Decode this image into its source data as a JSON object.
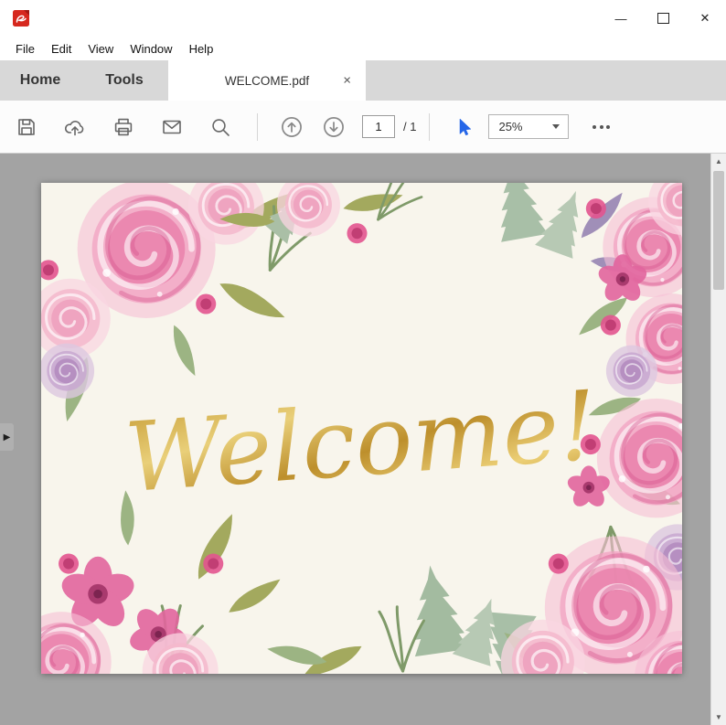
{
  "window": {
    "minimize_glyph": "—",
    "close_glyph": "✕"
  },
  "menu": {
    "items": [
      "File",
      "Edit",
      "View",
      "Window",
      "Help"
    ]
  },
  "tabs": {
    "home": "Home",
    "tools": "Tools",
    "document": "WELCOME.pdf",
    "close_glyph": "×"
  },
  "toolbar": {
    "page_current": "1",
    "page_total": "/ 1",
    "zoom_value": "25%"
  },
  "document": {
    "welcome_text": "Welcome!"
  },
  "scrollbar": {
    "up_glyph": "▲",
    "down_glyph": "▼"
  },
  "panel": {
    "expand_glyph": "▶"
  },
  "icons": {
    "titlebar": [
      "pdf-app-icon",
      "minimize-icon",
      "maximize-icon",
      "close-icon"
    ],
    "toolbar": [
      "save-icon",
      "upload-cloud-icon",
      "print-icon",
      "email-icon",
      "search-icon",
      "page-up-icon",
      "page-down-icon",
      "select-arrow-icon",
      "zoom-caret-icon",
      "more-dots-icon"
    ],
    "other": [
      "tab-close-icon",
      "panel-expand-arrow-icon",
      "scroll-up-icon",
      "scroll-down-icon"
    ]
  },
  "colors": {
    "accent_blue": "#2566e8",
    "gold": "#c9a23a",
    "doc_background": "#a3a3a3",
    "tab_background": "#d8d8d8"
  }
}
